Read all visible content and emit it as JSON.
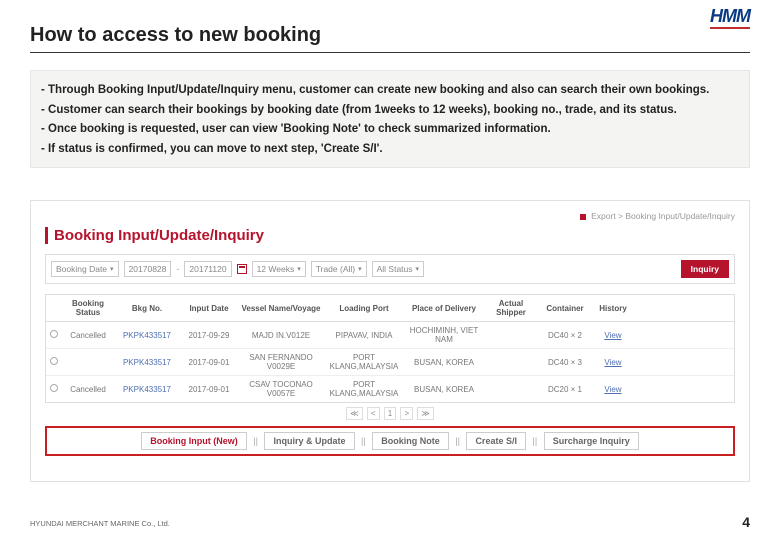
{
  "logo_text": "HMM",
  "slide_title": "How to access to new booking",
  "bullets": [
    "Through Booking Input/Update/Inquiry menu, customer can create new booking and also can search their own bookings.",
    "Customer can search their bookings by booking date (from 1weeks to 12 weeks), booking no., trade, and its status.",
    "Once booking is requested, user can view 'Booking Note' to check summarized information.",
    "If status is confirmed, you can move to next step, 'Create S/I'."
  ],
  "breadcrumb": "Export > Booking Input/Update/Inquiry",
  "page_heading": "Booking Input/Update/Inquiry",
  "filters": {
    "date_type": "Booking Date",
    "date_from": "20170828",
    "date_to": "20171120",
    "weeks": "12 Weeks",
    "trade": "Trade (All)",
    "status": "All Status",
    "inquiry_label": "Inquiry"
  },
  "table": {
    "headers": [
      "",
      "Booking Status",
      "Bkg No.",
      "Input Date",
      "Vessel Name/Voyage",
      "Loading Port",
      "Place of Delivery",
      "Actual Shipper",
      "Container",
      "History"
    ],
    "rows": [
      {
        "status": "Cancelled",
        "bkg": "PKPK433517",
        "date": "2017-09-29",
        "vess": "MAJD IN.V012E",
        "load": "PIPAVAV, INDIA",
        "pod": "HOCHIMINH, VIET NAM",
        "shipper": "",
        "ctnr": "DC40 × 2",
        "hist": "View"
      },
      {
        "status": "",
        "bkg": "PKPK433517",
        "date": "2017-09-01",
        "vess": "SAN FERNANDO V0029E",
        "load": "PORT KLANG,MALAYSIA",
        "pod": "BUSAN, KOREA",
        "shipper": "",
        "ctnr": "DC40 × 3",
        "hist": "View"
      },
      {
        "status": "Cancelled",
        "bkg": "PKPK433517",
        "date": "2017-09-01",
        "vess": "CSAV TOCONAO V0057E",
        "load": "PORT KLANG,MALAYSIA",
        "pod": "BUSAN, KOREA",
        "shipper": "",
        "ctnr": "DC20 × 1",
        "hist": "View"
      }
    ]
  },
  "pager": {
    "first": "≪",
    "prev": "<",
    "page": "1",
    "next": ">",
    "last": "≫"
  },
  "actions": [
    "Booking Input (New)",
    "Inquiry & Update",
    "Booking Note",
    "Create S/I",
    "Surcharge Inquiry"
  ],
  "footer_left": "HYUNDAI MERCHANT MARINE Co., Ltd.",
  "page_number": "4"
}
